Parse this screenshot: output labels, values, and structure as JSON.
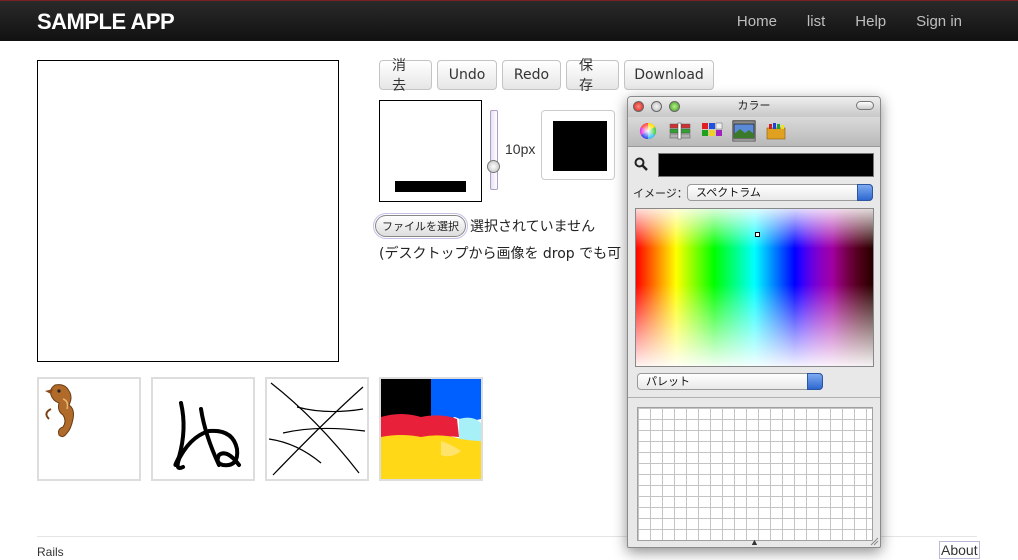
{
  "app": {
    "brand": "SAMPLE APP",
    "nav": [
      "Home",
      "list",
      "Help",
      "Sign in"
    ]
  },
  "toolbar": {
    "clear_label": "消去",
    "undo_label": "Undo",
    "redo_label": "Redo",
    "save_label": "保存",
    "download_label": "Download"
  },
  "brush": {
    "size_label": "10px",
    "size_level_fraction": 0.75,
    "current_color": "#000000"
  },
  "file": {
    "button_label": "ファイルを選択",
    "status_text": "選択されていません",
    "drop_note": "(デスクトップから画像を drop でも可"
  },
  "thumbnails": [
    {
      "name": "seahorse-thumbnail"
    },
    {
      "name": "scribble-nu-thumbnail"
    },
    {
      "name": "lines-thumbnail"
    },
    {
      "name": "color-blocks-thumbnail"
    }
  ],
  "footer": {
    "left": "Rails",
    "right": "About"
  },
  "color_panel": {
    "title": "カラー",
    "image_label": "イメージ：",
    "image_select_value": "スペクトラム",
    "palette_select_value": "パレット",
    "hex_color": "#000000",
    "tabs": [
      "color-wheel-tab",
      "sliders-tab",
      "palettes-tab",
      "image-palettes-tab",
      "crayons-tab"
    ],
    "selected_tab": "image-palettes-tab"
  }
}
